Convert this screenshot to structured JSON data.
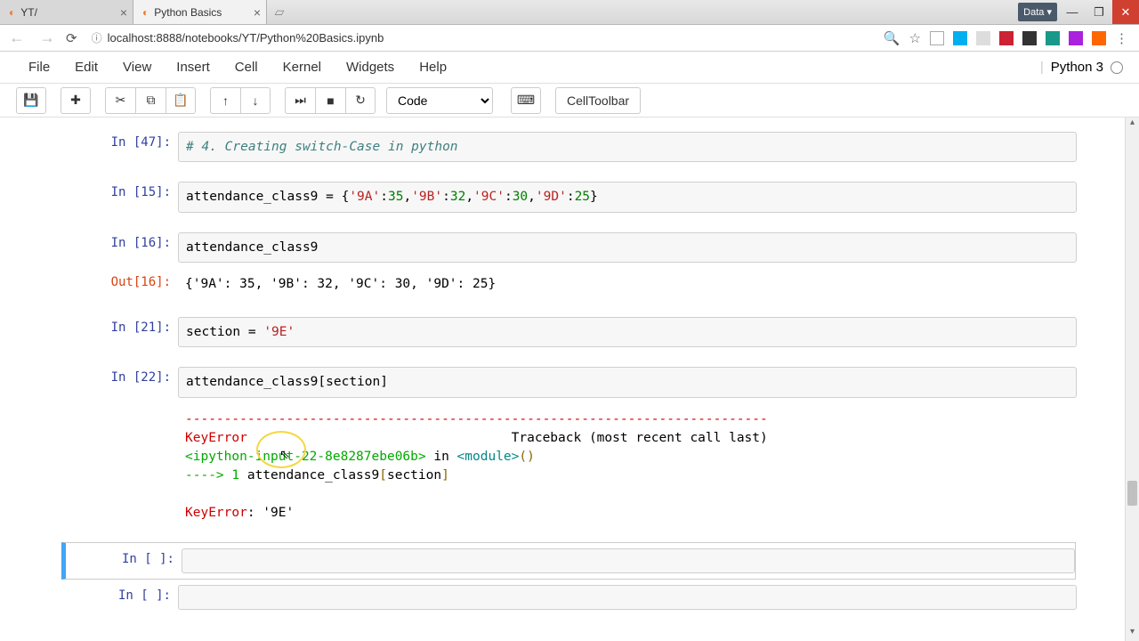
{
  "tabs": [
    {
      "title": "YT/",
      "active": false
    },
    {
      "title": "Python Basics",
      "active": true
    }
  ],
  "url": "localhost:8888/notebooks/YT/Python%20Basics.ipynb",
  "data_button": "Data ▾",
  "menu": {
    "file": "File",
    "edit": "Edit",
    "view": "View",
    "insert": "Insert",
    "cell": "Cell",
    "kernel": "Kernel",
    "widgets": "Widgets",
    "help": "Help"
  },
  "kernel": "Python 3",
  "toolbar": {
    "celltype": "Code",
    "celltoolbar": "CellToolbar"
  },
  "cells": [
    {
      "prompt": "In [47]:",
      "type": "in",
      "code_html": "<span class='comment'># 4. Creating switch-Case in python</span>"
    },
    {
      "prompt": "In [15]:",
      "type": "in",
      "code_html": "attendance_class9 = {<span class='str'>'9A'</span>:<span class='num'>35</span>,<span class='str'>'9B'</span>:<span class='num'>32</span>,<span class='str'>'9C'</span>:<span class='num'>30</span>,<span class='str'>'9D'</span>:<span class='num'>25</span>}"
    },
    {
      "prompt": "In [16]:",
      "type": "in",
      "code_html": "attendance_class9"
    },
    {
      "prompt": "Out[16]:",
      "type": "out",
      "output": "{'9A': 35, '9B': 32, '9C': 30, '9D': 25}"
    },
    {
      "prompt": "In [21]:",
      "type": "in",
      "code_html": "section = <span class='str'>'9E'</span>"
    },
    {
      "prompt": "In [22]:",
      "type": "in",
      "code_html": "attendance_class9[section]"
    },
    {
      "prompt": "",
      "type": "err",
      "output_html": "<span class='err-red'>---------------------------------------------------------------------------</span>\n<span class='err-red'>KeyError</span>                                  Traceback (most recent call last)\n<span class='err-green'>&lt;ipython-input-22-8e8287ebe06b&gt;</span> in <span class='err-cyan'>&lt;module&gt;</span><span class='err-yellow'>()</span>\n<span class='err-green'>----&gt; 1</span> attendance_class9<span class='err-yellow'>[</span>section<span class='err-yellow'>]</span>\n\n<span class='err-red'>KeyError</span>: '9E'"
    },
    {
      "prompt": "In [ ]:",
      "type": "in",
      "code_html": "",
      "selected": true
    },
    {
      "prompt": "In [ ]:",
      "type": "in",
      "code_html": ""
    }
  ]
}
